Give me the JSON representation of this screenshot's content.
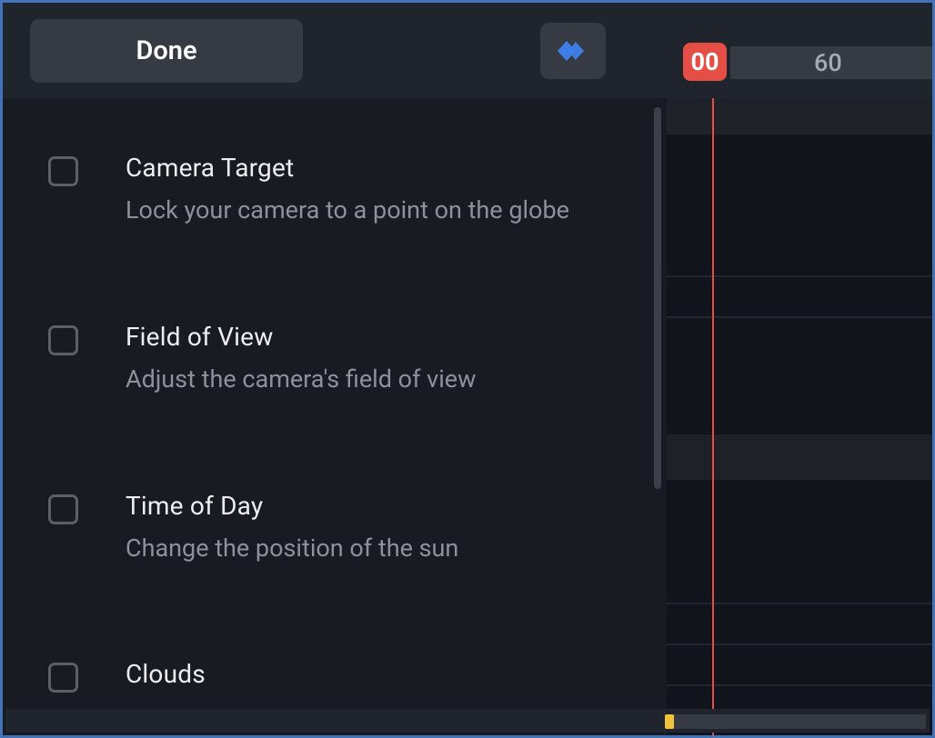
{
  "toolbar": {
    "done_label": "Done",
    "keyframe_icon": "keyframe-add-icon"
  },
  "timeline": {
    "current_frame": "00",
    "next_tick": "60"
  },
  "options": [
    {
      "title": "Camera Target",
      "desc": "Lock your camera to a point on the globe"
    },
    {
      "title": "Field of View",
      "desc": "Adjust the camera's field of view"
    },
    {
      "title": "Time of Day",
      "desc": "Change the position of the sun"
    },
    {
      "title": "Clouds",
      "desc": ""
    }
  ],
  "colors": {
    "accent_red": "#e44e45",
    "accent_blue": "#3e7ee8",
    "accent_yellow": "#f2c13e",
    "frame_border": "#4273b8"
  }
}
